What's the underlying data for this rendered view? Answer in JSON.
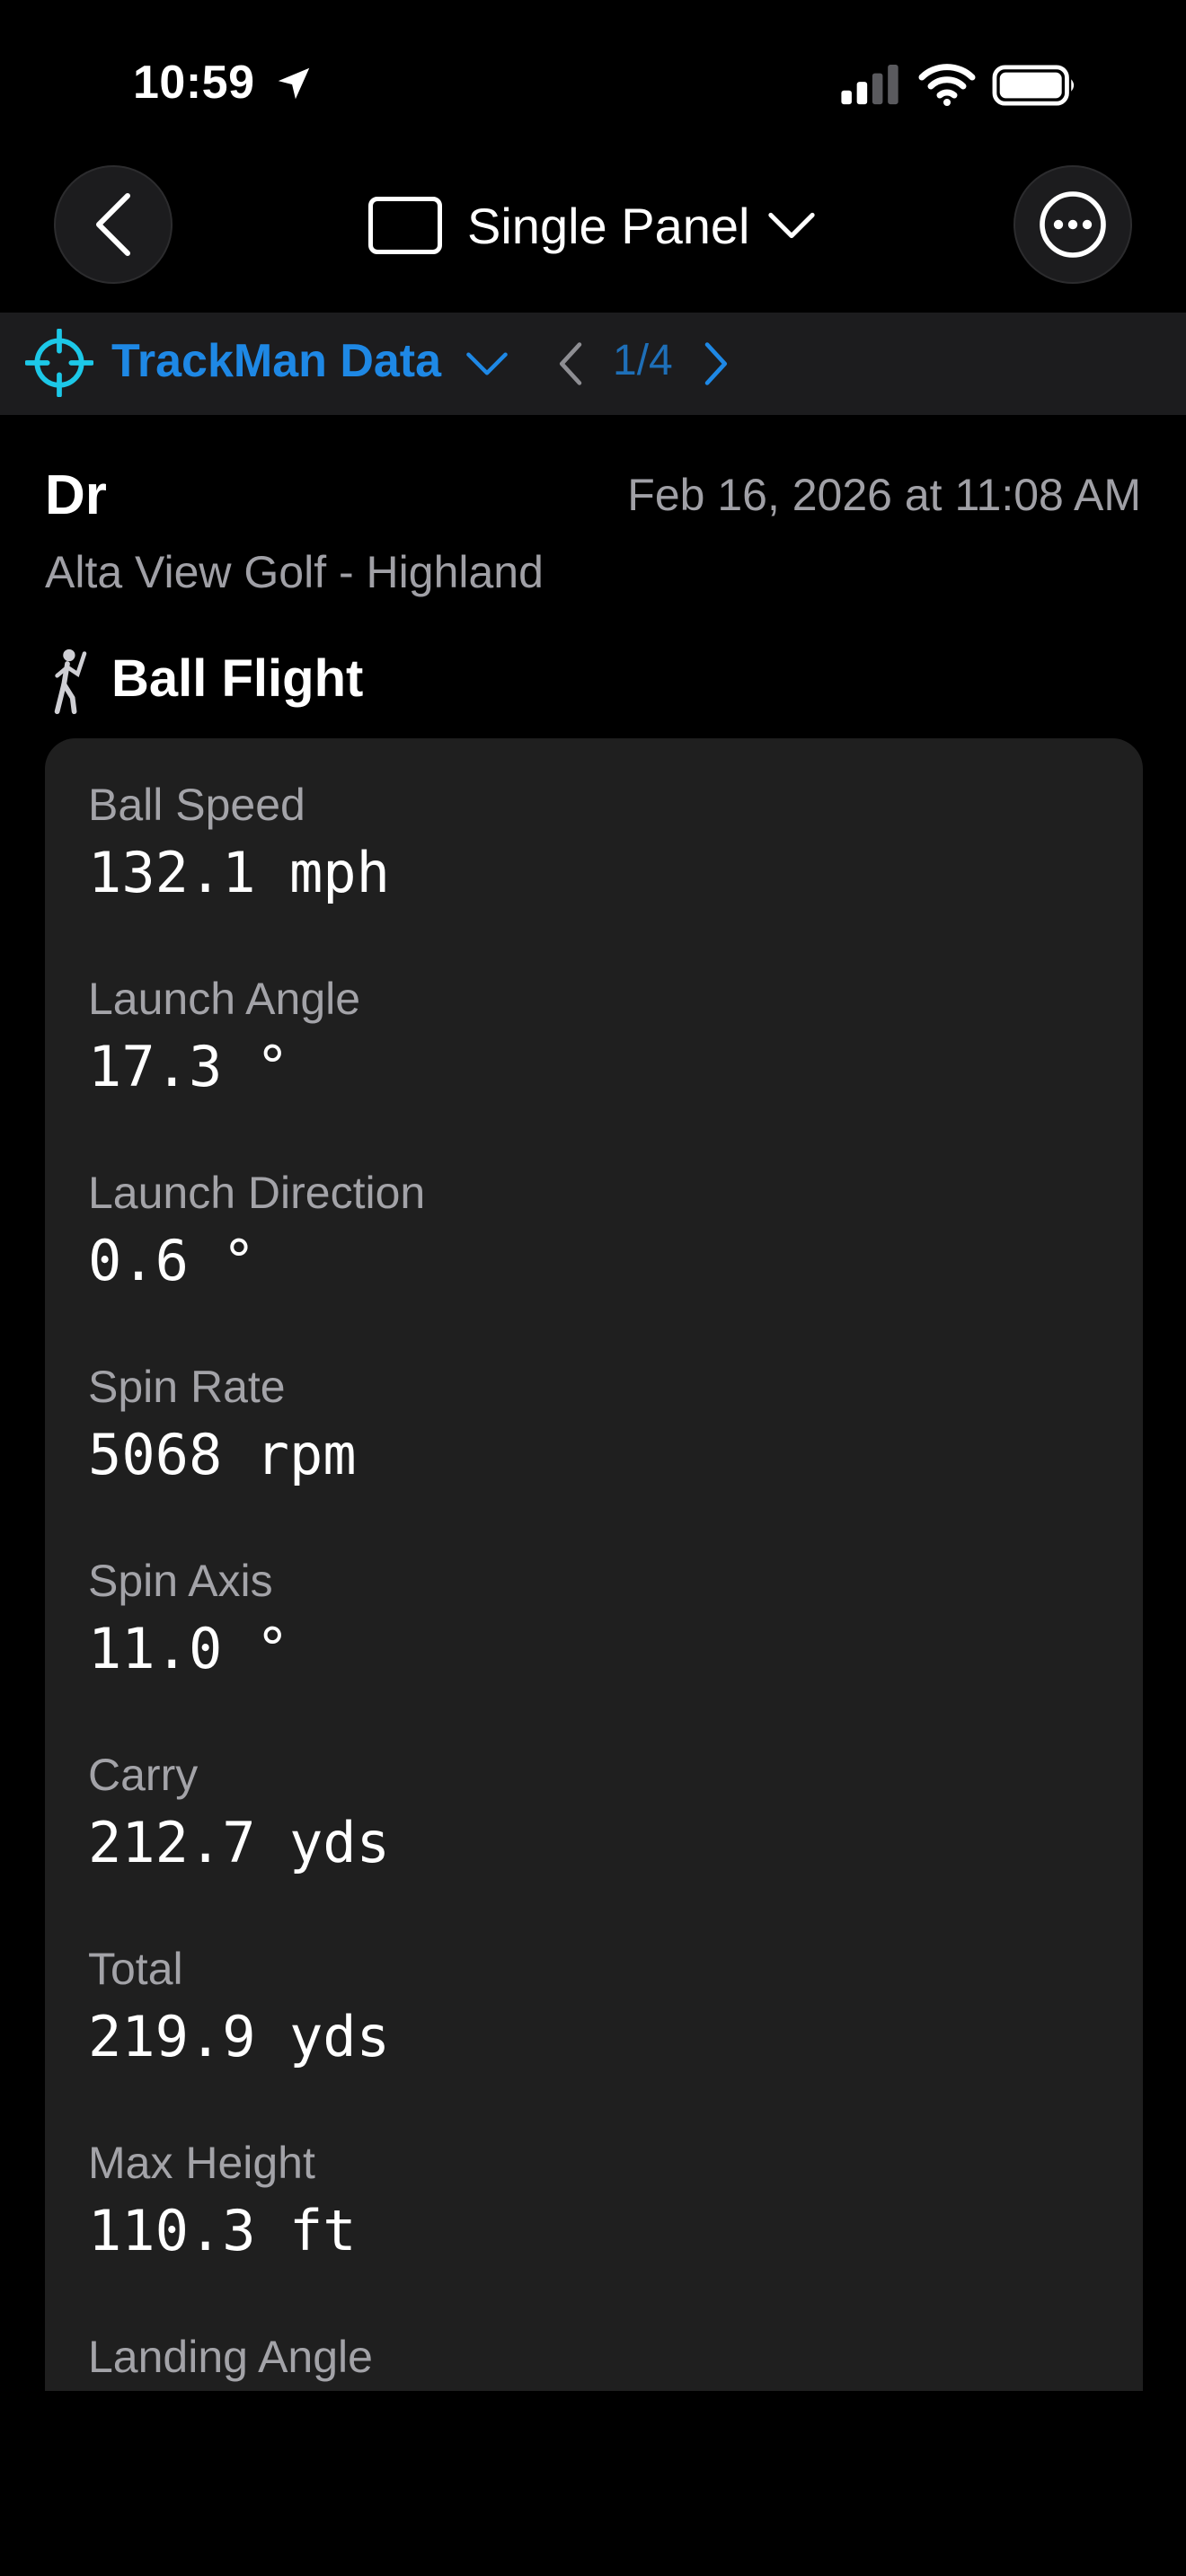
{
  "status_bar": {
    "time": "10:59"
  },
  "nav": {
    "title": "Single Panel"
  },
  "subbar": {
    "source": "TrackMan Data",
    "pager": "1/4"
  },
  "shot": {
    "club": "Dr",
    "date": "Feb 16, 2026 at 11:08 AM",
    "location": "Alta View Golf - Highland"
  },
  "section": {
    "title": "Ball Flight"
  },
  "metrics": [
    {
      "label": "Ball Speed",
      "value": "132.1 mph"
    },
    {
      "label": "Launch Angle",
      "value": "17.3 °"
    },
    {
      "label": "Launch Direction",
      "value": "0.6 °"
    },
    {
      "label": "Spin Rate",
      "value": "5068 rpm"
    },
    {
      "label": "Spin Axis",
      "value": "11.0 °"
    },
    {
      "label": "Carry",
      "value": "212.7 yds"
    },
    {
      "label": "Total",
      "value": "219.9 yds"
    },
    {
      "label": "Max Height",
      "value": "110.3 ft"
    },
    {
      "label": "Landing Angle",
      "value": ""
    }
  ],
  "colors": {
    "accent": "#1e88e5",
    "target_icon": "#1cc8e8",
    "card": "#1f1f1f",
    "subbar": "#1c1c1e"
  },
  "icons": [
    "location-arrow-icon",
    "cellular-signal-icon",
    "wifi-icon",
    "battery-icon",
    "chevron-left-icon",
    "ellipsis-icon",
    "panel-icon",
    "chevron-down-icon",
    "crosshair-icon",
    "golfer-icon"
  ]
}
